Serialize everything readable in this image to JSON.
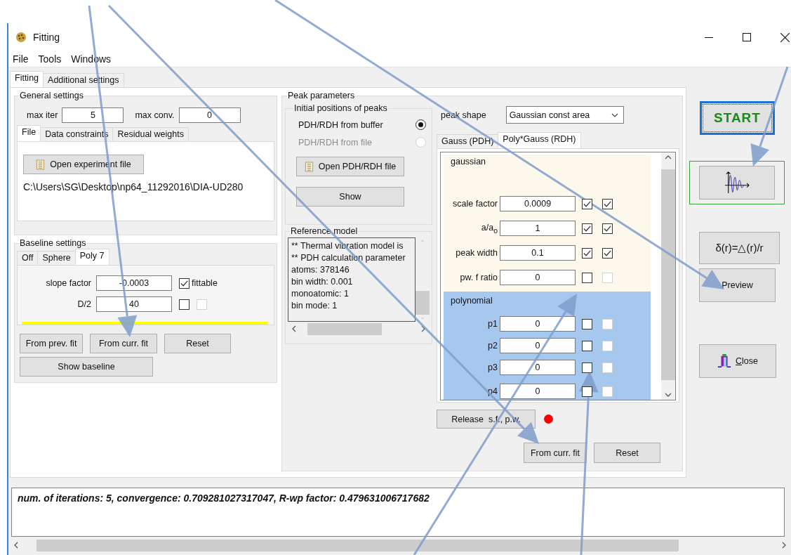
{
  "window": {
    "title": "Fitting"
  },
  "menu": [
    "File",
    "Tools",
    "Windows"
  ],
  "tabs": [
    {
      "label": "Fitting",
      "selected": true
    },
    {
      "label": "Additional settings",
      "selected": false
    }
  ],
  "general_settings": {
    "title": "General settings",
    "fields": [
      {
        "label": "max iter",
        "value": "5"
      },
      {
        "label": "max conv.",
        "value": "0"
      }
    ],
    "tabs": [
      {
        "label": "File",
        "selected": true
      },
      {
        "label": "Data constraints",
        "selected": false
      },
      {
        "label": "Residual weights",
        "selected": false
      }
    ],
    "open_button": "Open experiment file",
    "path": "C:\\Users\\SG\\Desktop\\np64_11292016\\DIA-UD280"
  },
  "baseline_settings": {
    "title": "Baseline settings",
    "tabs": [
      {
        "label": "Off",
        "selected": false
      },
      {
        "label": "Sphere",
        "selected": false
      },
      {
        "label": "Poly 7",
        "selected": true
      }
    ],
    "params": [
      {
        "label": "slope factor",
        "value": "-0.0003",
        "checks": [
          {
            "checked": true,
            "disabled": false
          }
        ],
        "check_label": "fittable"
      },
      {
        "label": "D/2",
        "value": "40",
        "checks": [
          {
            "checked": false,
            "disabled": false
          },
          {
            "checked": false,
            "disabled": true
          }
        ]
      }
    ],
    "buttons": [
      "From prev. fit",
      "From curr. fit",
      "Reset"
    ],
    "show_button": "Show baseline"
  },
  "peak_parameters": {
    "title": "Peak parameters",
    "initial_positions": {
      "title": "Initial positions of peaks",
      "options": [
        {
          "label": "PDH/RDH from buffer",
          "selected": true,
          "disabled": false
        },
        {
          "label": "PDH/RDH from file",
          "selected": false,
          "disabled": true
        }
      ],
      "open_button": "Open PDH/RDH file",
      "show_button": "Show"
    },
    "reference_model": {
      "title": "Reference model",
      "lines": [
        "** Thermal vibration model is",
        "** PDH calculation parameter",
        "atoms: 378146",
        "bin width: 0.001",
        "monoatomic: 1",
        "bin mode: 1"
      ]
    },
    "peak_shape": {
      "label": "peak shape",
      "value": "Gaussian const area"
    },
    "tabs": [
      {
        "label": "Gauss (PDH)",
        "selected": false
      },
      {
        "label": "Poly*Gauss (RDH)",
        "selected": true
      }
    ],
    "sections": [
      {
        "title": "gaussian",
        "kind": "gaussian",
        "rows": [
          {
            "label": "scale factor",
            "value": "0.0009",
            "checks": [
              {
                "checked": true,
                "disabled": false
              },
              {
                "checked": true,
                "disabled": false
              }
            ]
          },
          {
            "label": "a/a$_{o}$",
            "value": "1",
            "checks": [
              {
                "checked": true,
                "disabled": false
              },
              {
                "checked": true,
                "disabled": false
              }
            ]
          },
          {
            "label": "peak width",
            "value": "0.1",
            "checks": [
              {
                "checked": true,
                "disabled": false
              },
              {
                "checked": true,
                "disabled": false
              }
            ]
          },
          {
            "label": "pw.  f ratio",
            "value": "0",
            "checks": [
              {
                "checked": false,
                "disabled": false
              },
              {
                "checked": false,
                "disabled": true
              }
            ]
          }
        ]
      },
      {
        "title": "polynomial",
        "kind": "polynomial",
        "rows": [
          {
            "label": "p1",
            "value": "0",
            "checks": [
              {
                "checked": false,
                "disabled": false
              },
              {
                "checked": false,
                "disabled": true
              }
            ]
          },
          {
            "label": "p2",
            "value": "0",
            "checks": [
              {
                "checked": false,
                "disabled": false
              },
              {
                "checked": false,
                "disabled": true
              }
            ]
          },
          {
            "label": "p3",
            "value": "0",
            "checks": [
              {
                "checked": false,
                "disabled": false
              },
              {
                "checked": false,
                "disabled": true
              }
            ]
          },
          {
            "label": "p4",
            "value": "0",
            "checks": [
              {
                "checked": false,
                "disabled": false
              },
              {
                "checked": false,
                "disabled": true
              }
            ]
          }
        ]
      }
    ],
    "release_button": "Release  s.f., p.w.",
    "status_dot": {
      "color": "#ff0000"
    },
    "buttons": [
      "From curr. fit",
      "Reset"
    ]
  },
  "side_buttons": [
    {
      "kind": "start",
      "label": "START"
    },
    {
      "kind": "plot"
    },
    {
      "kind": "text",
      "label": "δ(r)=△(r)/r"
    },
    {
      "kind": "text",
      "label": "Preview"
    },
    {
      "kind": "close",
      "label": "Close"
    }
  ],
  "log": {
    "text": "num. of iterations: 5, convergence: 0.709281027317047, R-wp factor: 0.479631006717682"
  }
}
